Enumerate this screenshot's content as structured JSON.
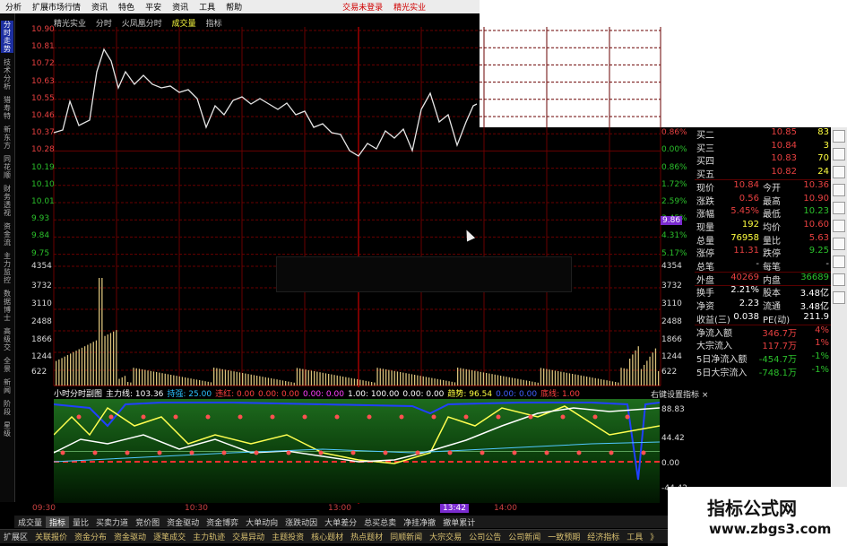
{
  "menu": [
    {
      "label": "分析",
      "red": false
    },
    {
      "label": "扩展市场行情",
      "red": false
    },
    {
      "label": "资讯",
      "red": false
    },
    {
      "label": "特色",
      "red": false
    },
    {
      "label": "平安",
      "red": false
    },
    {
      "label": "资讯",
      "red": false
    },
    {
      "label": "工具",
      "red": false
    },
    {
      "label": "帮助",
      "red": false
    },
    {
      "label": "交易未登录",
      "red": true
    },
    {
      "label": "精光实业",
      "red": true
    }
  ],
  "side_tabs": [
    "分时走势",
    "技术分析",
    "猎寿特",
    "新东方",
    "同花顺",
    "财务透视",
    "资金流",
    "主力监控",
    "数据博士",
    "高级交",
    "全景",
    "新闻",
    "阶段",
    "星级"
  ],
  "chart_header": {
    "name": "精光实业",
    "period": "分时",
    "indicator": "火凤凰分时",
    "vol_label": "成交量",
    "ind_label": "指标"
  },
  "price_axis_left": [
    "10.90",
    "10.81",
    "10.72",
    "10.63",
    "10.55",
    "10.46",
    "10.37",
    "10.28",
    "10.19",
    "10.10",
    "10.01",
    "9.93",
    "9.84",
    "9.75"
  ],
  "price_axis_right": [
    "",
    "",
    "",
    "",
    "",
    "",
    "0.86%",
    "0.00%",
    "0.86%",
    "1.72%",
    "2.59%",
    "3.45%",
    "4.31%",
    "5.17%"
  ],
  "current_price_badge": "9.86",
  "volume_axis": [
    "4354",
    "3732",
    "3110",
    "2488",
    "1866",
    "1244",
    "622"
  ],
  "osc_header": [
    {
      "t": "小时分时副图",
      "c": "#ffffff"
    },
    {
      "t": "主力线: 103.36",
      "c": "#ffffff"
    },
    {
      "t": "持强: 25.00",
      "c": "#2bc0ff"
    },
    {
      "t": "违红: 0.00",
      "c": "#ff4040"
    },
    {
      "t": "0.00: 0.00",
      "c": "#ff4040"
    },
    {
      "t": "0.00: 0.00",
      "c": "#ff40ff"
    },
    {
      "t": "1.00: 100.00",
      "c": "#ffffff"
    },
    {
      "t": "0.00: 0.00",
      "c": "#ffffff"
    },
    {
      "t": "趋势: 96.54",
      "c": "#ffff40"
    },
    {
      "t": "0.00: 0.00",
      "c": "#4060ff"
    },
    {
      "t": "底线: 1.00",
      "c": "#ff4040"
    }
  ],
  "osc_right_label": "右键设置指标",
  "osc_axis": [
    "88.83",
    "44.42",
    "0.00",
    "-44.42"
  ],
  "time_axis": {
    "t1": "09:30",
    "t2": "10:30",
    "t3": "13:00",
    "t4": "13:42",
    "t5": "14:00"
  },
  "tabs_row1": [
    "成交量",
    "指标",
    "量比",
    "买卖力道",
    "竞价图",
    "资金驱动",
    "资金博弈",
    "大单动向",
    "涨跌动因",
    "大单差分",
    "总买总卖",
    "净挂净撤",
    "撤单累计"
  ],
  "tabs_row2": [
    "扩展区",
    "关联报价",
    "资金分布",
    "资金驱动",
    "逐笔成交",
    "主力轨迹",
    "交易异动",
    "主题投资",
    "核心题材",
    "热点题材",
    "同顺新闻",
    "大宗交易",
    "公司公告",
    "公司新闻",
    "一致预期",
    "经济指标",
    "工具",
    "》"
  ],
  "quote_rows": [
    {
      "k": "买二",
      "v": "10.85",
      "k2": "",
      "v2": "83",
      "vc": "#e84040",
      "v2c": "#ffff40"
    },
    {
      "k": "买三",
      "v": "10.84",
      "k2": "",
      "v2": "3",
      "vc": "#e84040",
      "v2c": "#ffff40"
    },
    {
      "k": "买四",
      "v": "10.83",
      "k2": "",
      "v2": "70",
      "vc": "#e84040",
      "v2c": "#ffff40"
    },
    {
      "k": "买五",
      "v": "10.82",
      "k2": "",
      "v2": "24",
      "vc": "#e84040",
      "v2c": "#ffff40"
    },
    {
      "k": "现价",
      "v": "10.84",
      "k2": "今开",
      "v2": "10.36",
      "vc": "#e84040",
      "v2c": "#e84040"
    },
    {
      "k": "涨跌",
      "v": "0.56",
      "k2": "最高",
      "v2": "10.90",
      "vc": "#e84040",
      "v2c": "#e84040"
    },
    {
      "k": "涨幅",
      "v": "5.45%",
      "k2": "最低",
      "v2": "10.23",
      "vc": "#e84040",
      "v2c": "#2bc02b"
    },
    {
      "k": "现量",
      "v": "192",
      "k2": "均价",
      "v2": "10.60",
      "vc": "#ffff40",
      "v2c": "#e84040"
    },
    {
      "k": "总量",
      "v": "76958",
      "k2": "量比",
      "v2": "5.63",
      "vc": "#ffff40",
      "v2c": "#e84040"
    },
    {
      "k": "涨停",
      "v": "11.31",
      "k2": "跌停",
      "v2": "9.25",
      "vc": "#e84040",
      "v2c": "#2bc02b"
    },
    {
      "k": "总笔",
      "v": "-",
      "k2": "每笔",
      "v2": "-",
      "vc": "#dddddd",
      "v2c": "#dddddd"
    },
    {
      "k": "外盘",
      "v": "40269",
      "k2": "内盘",
      "v2": "36689",
      "vc": "#e84040",
      "v2c": "#2bc02b"
    },
    {
      "k": "换手",
      "v": "2.21%",
      "k2": "股本",
      "v2": "3.48亿",
      "vc": "#ffffff",
      "v2c": "#ffffff"
    },
    {
      "k": "净资",
      "v": "2.23",
      "k2": "流通",
      "v2": "3.48亿",
      "vc": "#ffffff",
      "v2c": "#ffffff"
    },
    {
      "k": "收益(三)",
      "v": "0.038",
      "k2": "PE(动)",
      "v2": "211.9",
      "vc": "#ffffff",
      "v2c": "#ffffff"
    },
    {
      "k": "净流入额",
      "v": "346.7万",
      "k2": "",
      "v2": "4%",
      "vc": "#e84040",
      "v2c": "#e84040"
    },
    {
      "k": "大宗流入",
      "v": "117.7万",
      "k2": "",
      "v2": "1%",
      "vc": "#e84040",
      "v2c": "#e84040"
    },
    {
      "k": "5日净流入额",
      "v": "-454.7万",
      "k2": "",
      "v2": "-1%",
      "vc": "#2bc02b",
      "v2c": "#2bc02b"
    },
    {
      "k": "5日大宗流入",
      "v": "-748.1万",
      "k2": "",
      "v2": "-1%",
      "vc": "#2bc02b",
      "v2c": "#2bc02b"
    }
  ],
  "watermark": {
    "line1": "指标公式网",
    "line2": "www.zbgs3.com"
  },
  "colors": {
    "grid": "#6a0000",
    "price_line": "#e6e6e6",
    "osc_yellow": "#ffff50",
    "osc_white": "#ffffff",
    "osc_blue": "#2040ff",
    "osc_cyan": "#50c8ff"
  }
}
